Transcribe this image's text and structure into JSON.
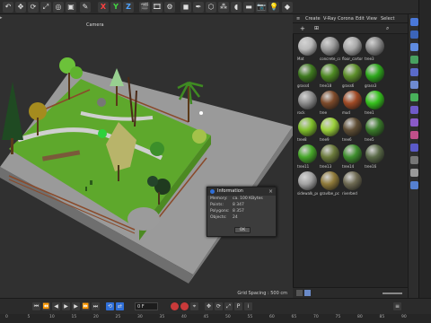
{
  "toolbar": {
    "axes": [
      "X",
      "Y",
      "Z"
    ]
  },
  "viewport": {
    "camera_label": "Camera",
    "grid_spacing": "Grid Spacing : 500 cm"
  },
  "info_dialog": {
    "title": "Information",
    "rows": [
      {
        "label": "Memory:",
        "value": "ca. 100 KBytes"
      },
      {
        "label": "Points:",
        "value": "8 347"
      },
      {
        "label": "Polygons:",
        "value": "8 357"
      },
      {
        "label": "Objects:",
        "value": "24"
      }
    ],
    "ok_label": "OK"
  },
  "menu": {
    "items": [
      "Create",
      "V-Ray",
      "Corona",
      "Edit",
      "View",
      "Select"
    ]
  },
  "materials": [
    {
      "label": "Mat",
      "color": "#b9b9b9"
    },
    {
      "label": "concrete_co",
      "color": "#9a9a9a"
    },
    {
      "label": "floor_carton",
      "color": "#a8a8a8"
    },
    {
      "label": "tree3",
      "color": "#8a8a8a"
    },
    {
      "label": "grass4",
      "color": "#3f7a1f"
    },
    {
      "label": "tree18",
      "color": "#4e8a22"
    },
    {
      "label": "grass6",
      "color": "#5d8f2a"
    },
    {
      "label": "grass3",
      "color": "#2ea81c"
    },
    {
      "label": "rock",
      "color": "#8c8c8c"
    },
    {
      "label": "tree",
      "color": "#7d4a2a"
    },
    {
      "label": "mud",
      "color": "#a04a25"
    },
    {
      "label": "tree1",
      "color": "#35c11c"
    },
    {
      "label": "tree8",
      "color": "#7fbf2a"
    },
    {
      "label": "tree9",
      "color": "#9bd13a"
    },
    {
      "label": "tree6",
      "color": "#5f4e35"
    },
    {
      "label": "tree5",
      "color": "#3a7a2a"
    },
    {
      "label": "tree11",
      "color": "#47a829"
    },
    {
      "label": "tree13",
      "color": "#6b7a3b"
    },
    {
      "label": "tree14",
      "color": "#3f8f2e"
    },
    {
      "label": "tree16",
      "color": "#5a6a48"
    },
    {
      "label": "sidewalk_pc",
      "color": "#a3a3a3"
    },
    {
      "label": "gravlbe_pc",
      "color": "#8f7a3a"
    },
    {
      "label": "riverbed",
      "color": "#6e6a52"
    }
  ],
  "timeline": {
    "frame_field": "0 F",
    "ticks": [
      "0",
      "5",
      "10",
      "15",
      "20",
      "25",
      "30",
      "35",
      "40",
      "45",
      "50",
      "55",
      "60",
      "65",
      "70",
      "75",
      "80",
      "85",
      "90"
    ]
  }
}
